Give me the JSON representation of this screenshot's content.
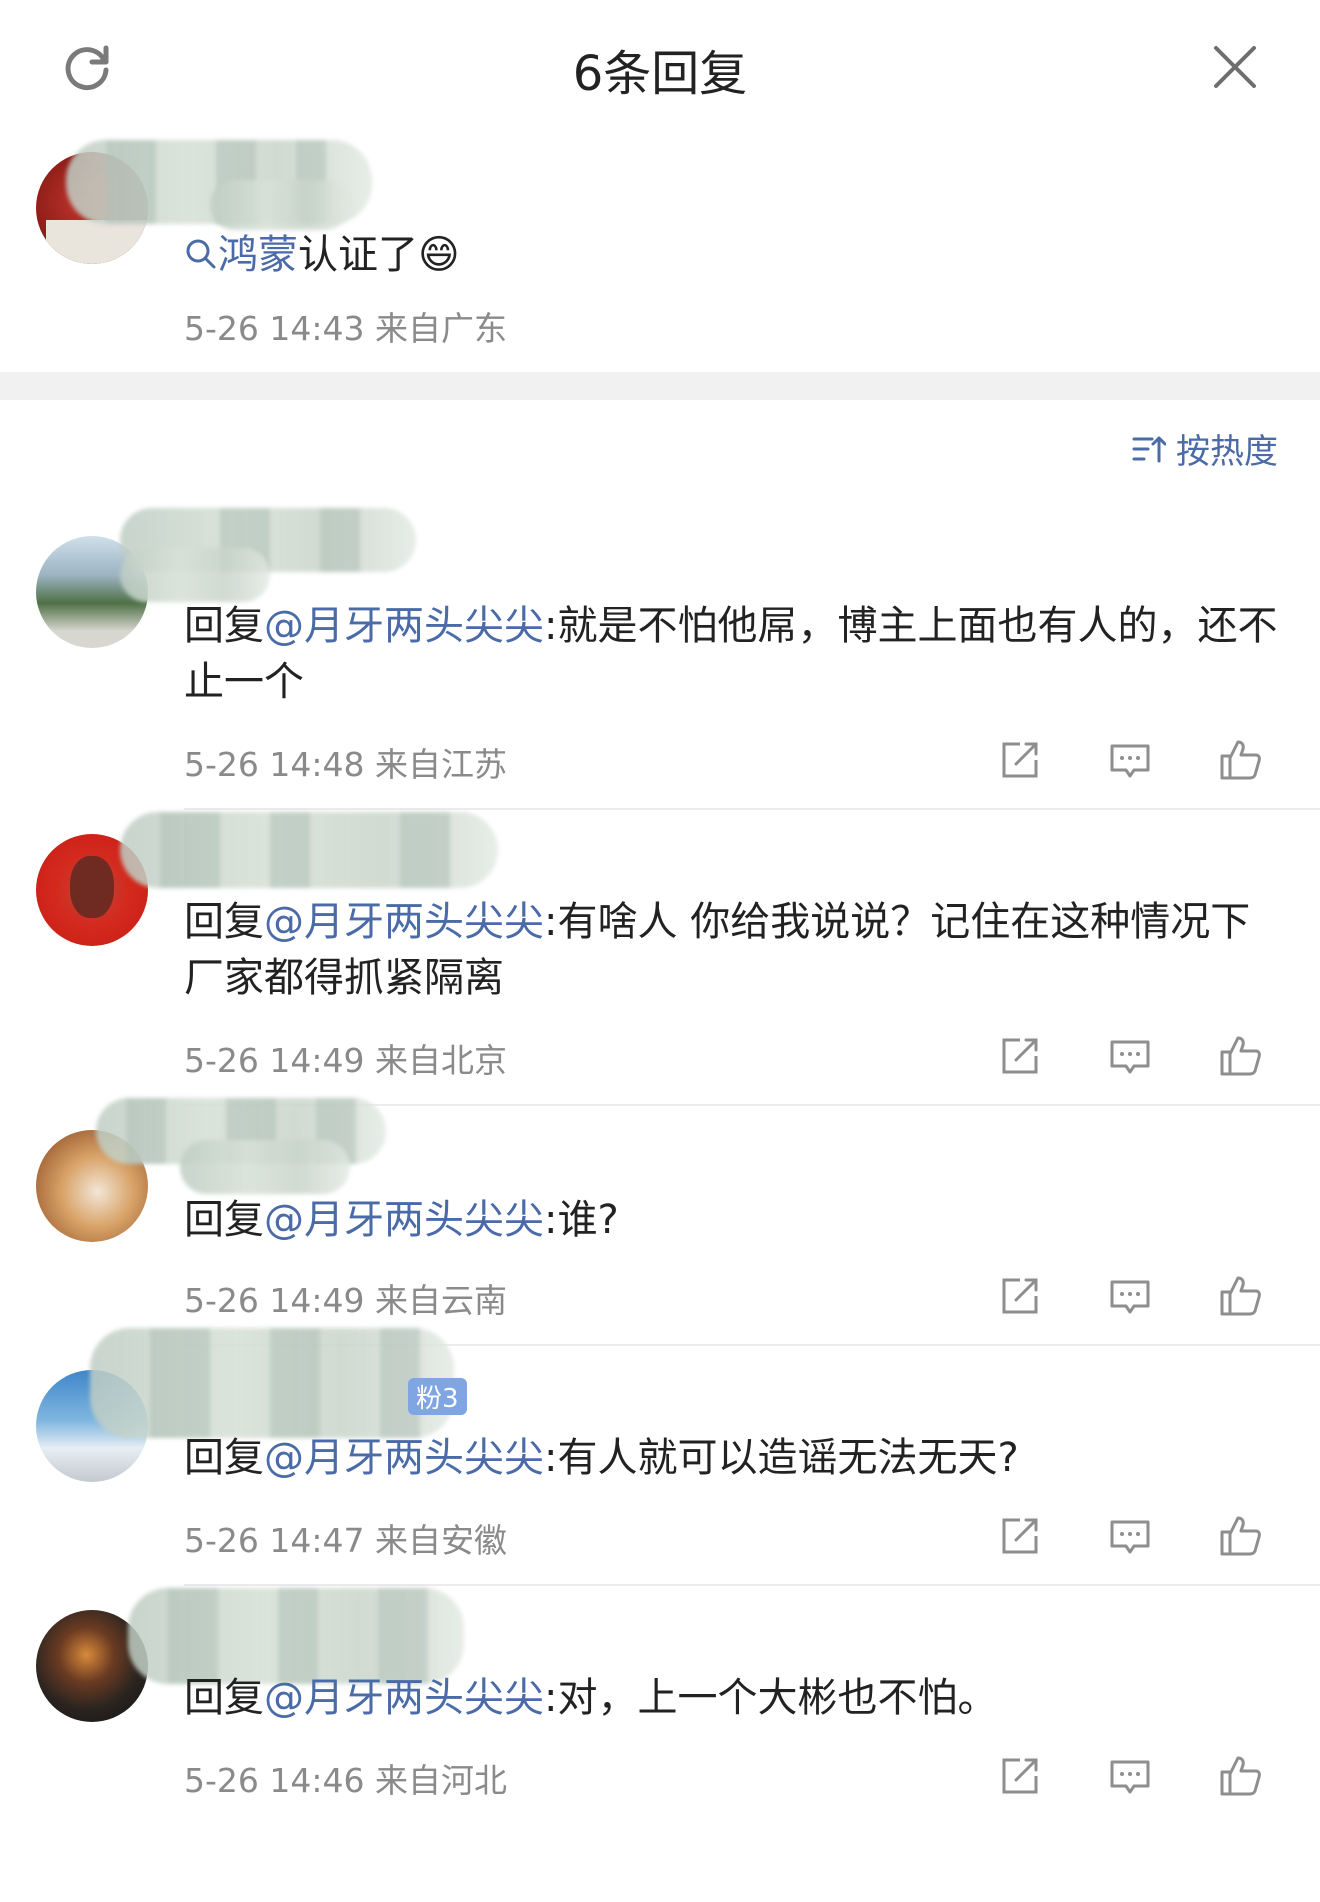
{
  "header": {
    "title": "6条回复",
    "refresh_icon": "refresh-icon",
    "close_icon": "close-icon"
  },
  "main_comment": {
    "search_tag": "鸿蒙",
    "text_rest": "认证了",
    "emoji": "😄",
    "meta": "5-26 14:43 来自广东"
  },
  "sort": {
    "label": "按热度",
    "icon": "sort-icon"
  },
  "replies": [
    {
      "prefix": "回复",
      "mention": "@月牙两头尖尖",
      "text": ":就是不怕他屌，博主上面也有人的，还不止一个",
      "meta": "5-26 14:48 来自江苏"
    },
    {
      "prefix": "回复",
      "mention": "@月牙两头尖尖",
      "text": ":有啥人 你给我说说？记住在这种情况下厂家都得抓紧隔离",
      "meta": "5-26 14:49 来自北京"
    },
    {
      "prefix": "回复",
      "mention": "@月牙两头尖尖",
      "text": ":谁?",
      "meta": "5-26 14:49 来自云南"
    },
    {
      "prefix": "回复",
      "mention": "@月牙两头尖尖",
      "text": ":有人就可以造谣无法无天?",
      "meta": "5-26 14:47 来自安徽",
      "badge": "粉3"
    },
    {
      "prefix": "回复",
      "mention": "@月牙两头尖尖",
      "text": ":对，上一个大彬也不怕。",
      "meta": "5-26 14:46 来自河北"
    }
  ],
  "colors": {
    "link": "#4a6aa8",
    "meta": "#8a8a8a",
    "icon": "#8e8e8e"
  }
}
